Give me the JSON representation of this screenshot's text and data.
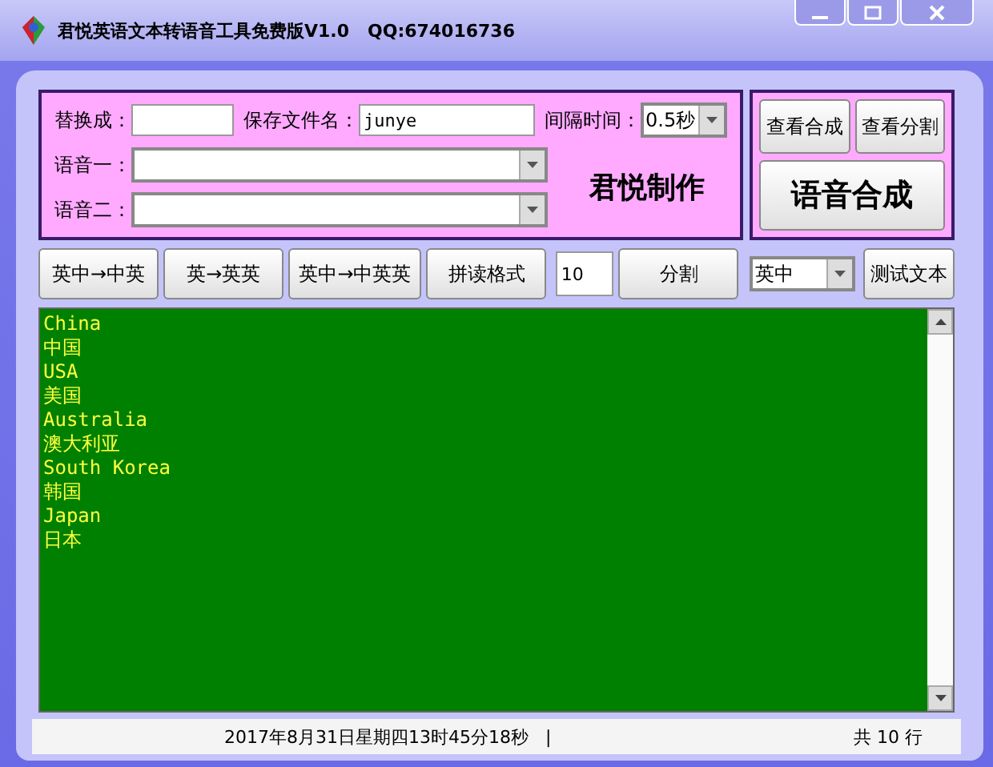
{
  "window": {
    "title": "君悦英语文本转语音工具免费版V1.0   QQ:674016736"
  },
  "form": {
    "replace_label": "替换成：",
    "filename_label": "保存文件名：",
    "filename_value": "junye",
    "interval_label": "间隔时间：",
    "interval_value": "0.5秒",
    "voice1_label": "语音一：",
    "voice2_label": "语音二：",
    "brand": "君悦制作"
  },
  "side_buttons": [
    "查看合成",
    "查看分割"
  ],
  "synth_button": "语音合成",
  "toolbar": {
    "buttons": [
      "英中→中英",
      "英→英英",
      "英中→中英英",
      "拼读格式"
    ],
    "count": "10",
    "split_button": "分割",
    "lang": "英中",
    "test_button": "测试文本"
  },
  "text_lines": [
    "China",
    "中国",
    "USA",
    "美国",
    "Australia",
    "澳大利亚",
    "South Korea",
    "韩国",
    "Japan",
    "日本"
  ],
  "status": {
    "datetime": "2017年8月31日星期四13时45分18秒   |",
    "lines": "共 10 行"
  }
}
